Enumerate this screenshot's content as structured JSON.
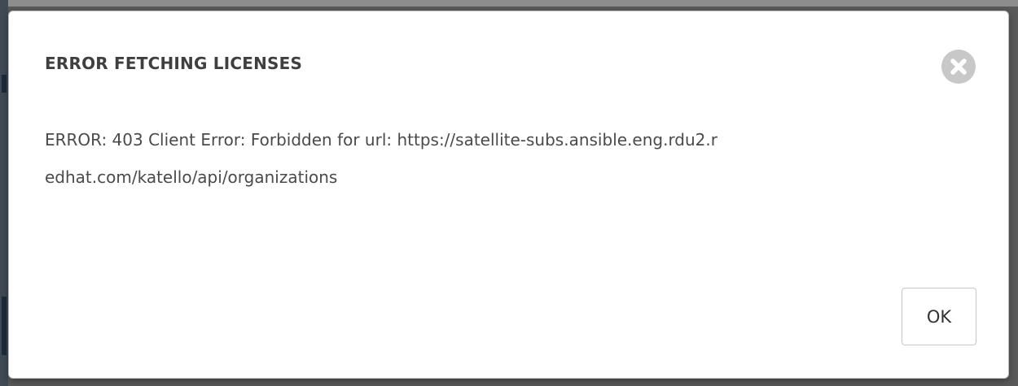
{
  "dialog": {
    "title": "ERROR FETCHING LICENSES",
    "message": "ERROR: 403 Client Error: Forbidden for url: https://satellite-subs.ansible.eng.rdu2.redhat.com/katello/api/organizations",
    "ok_label": "OK",
    "close_icon": "close-icon"
  },
  "colors": {
    "title": "#3f3f3f",
    "body_text": "#4a4a4a",
    "close_circle": "#c8c8c8",
    "button_border": "#c7c7c7"
  }
}
